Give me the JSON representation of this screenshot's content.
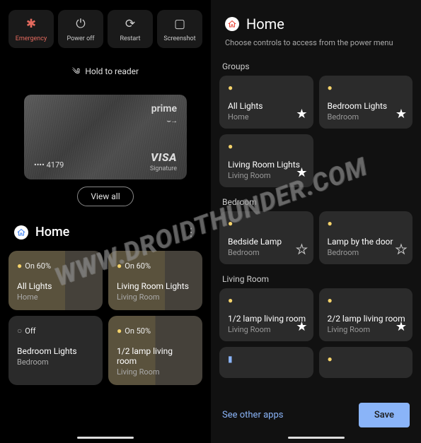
{
  "left": {
    "buttons": [
      {
        "label": "Emergency",
        "icon": "✱"
      },
      {
        "label": "Power off",
        "icon": "⏻"
      },
      {
        "label": "Restart",
        "icon": "⟳"
      },
      {
        "label": "Screenshot",
        "icon": "▢"
      }
    ],
    "nfc_label": "Hold to reader",
    "card": {
      "brand": "prime",
      "last4": "•••• 4179",
      "network": "VISA",
      "tier": "Signature"
    },
    "view_all": "View all",
    "home_title": "Home",
    "tiles": [
      {
        "status": "On 60%",
        "name": "All Lights",
        "room": "Home",
        "on": true,
        "pct": 60
      },
      {
        "status": "On 60%",
        "name": "Living Room Lights",
        "room": "Living Room",
        "on": true,
        "pct": 60
      },
      {
        "status": "Off",
        "name": "Bedroom Lights",
        "room": "Bedroom",
        "on": false,
        "pct": 0
      },
      {
        "status": "On 50%",
        "name": "1/2 lamp living room",
        "room": "Living Room",
        "on": true,
        "pct": 50
      }
    ]
  },
  "right": {
    "title": "Home",
    "subtitle": "Choose controls to access from the power menu",
    "sections": {
      "groups_label": "Groups",
      "bedroom_label": "Bedroom",
      "living_label": "Living Room"
    },
    "groups": [
      {
        "name": "All Lights",
        "room": "Home",
        "fav": true
      },
      {
        "name": "Bedroom Lights",
        "room": "Bedroom",
        "fav": true
      },
      {
        "name": "Living Room Lights",
        "room": "Living Room",
        "fav": true
      }
    ],
    "bedroom": [
      {
        "name": "Bedside Lamp",
        "room": "Bedroom",
        "fav": false
      },
      {
        "name": "Lamp by the door",
        "room": "Bedroom",
        "fav": false
      }
    ],
    "living": [
      {
        "name": "1/2 lamp living room",
        "room": "Living Room",
        "fav": true
      },
      {
        "name": "2/2 lamp living room",
        "room": "Living Room",
        "fav": true
      }
    ],
    "see_other": "See other apps",
    "save": "Save"
  },
  "watermark": "WWW.DROIDTHUNDER.COM"
}
